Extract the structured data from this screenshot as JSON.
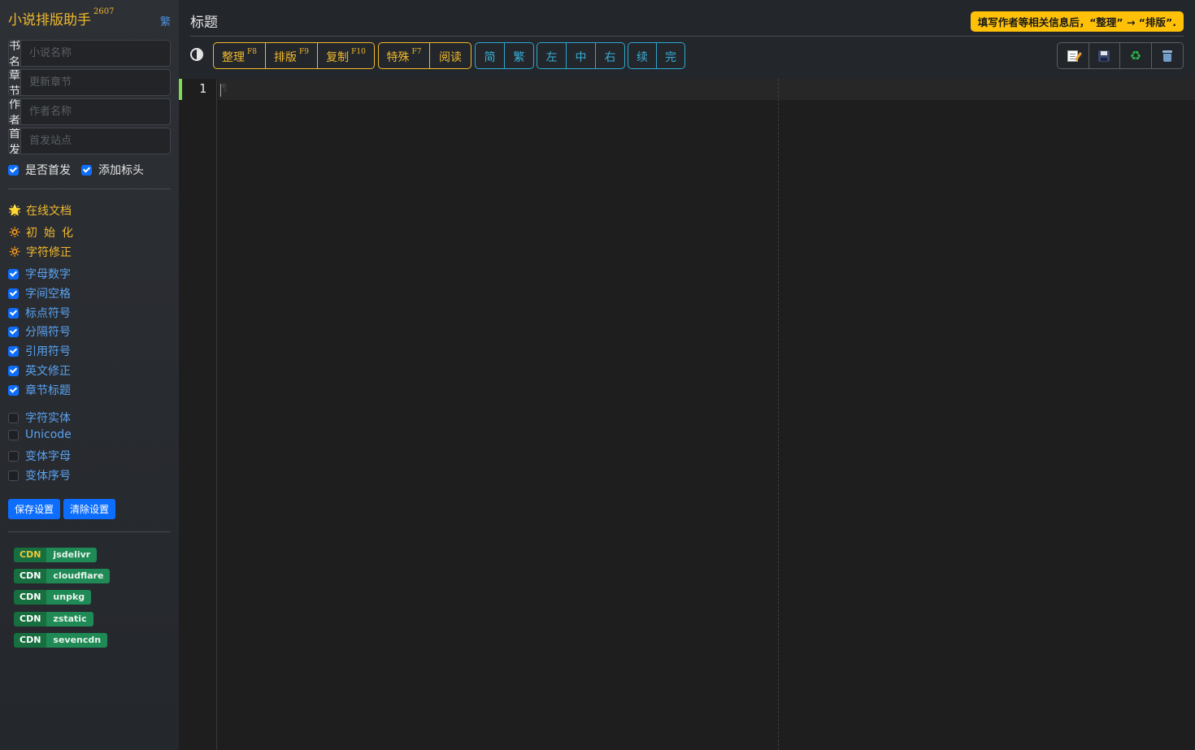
{
  "sidebar": {
    "app_name": "小说排版助手",
    "version": "2607",
    "trad_toggle": "繁",
    "fields": [
      {
        "label": "书名",
        "placeholder": "小说名称",
        "value": ""
      },
      {
        "label": "章节",
        "placeholder": "更新章节",
        "value": ""
      },
      {
        "label": "作者",
        "placeholder": "作者名称",
        "value": ""
      },
      {
        "label": "首发",
        "placeholder": "首发站点",
        "value": ""
      }
    ],
    "first_publish_label": "是否首发",
    "add_header_label": "添加标头",
    "actions": [
      {
        "icon": "star-icon",
        "label": "在线文档"
      },
      {
        "icon": "sun-icon",
        "label": "初始化"
      },
      {
        "icon": "sun-icon",
        "label": "字符修正"
      }
    ],
    "options_checked": [
      "字母数字",
      "字间空格",
      "标点符号",
      "分隔符号",
      "引用符号",
      "英文修正",
      "章节标题"
    ],
    "options_unchecked": [
      "字符实体",
      "Unicode",
      "变体字母",
      "变体序号"
    ],
    "save_label": "保存设置",
    "clear_label": "清除设置",
    "cdn_tag": "CDN",
    "cdns": [
      "jsdelivr",
      "cloudflare",
      "unpkg",
      "zstatic",
      "sevencdn"
    ]
  },
  "main": {
    "title": "标题",
    "hint": "填写作者等相关信息后，“整理” → “排版”.",
    "toolbar": {
      "group1": [
        {
          "label": "整理",
          "key": "F8"
        },
        {
          "label": "排版",
          "key": "F9"
        },
        {
          "label": "复制",
          "key": "F10"
        }
      ],
      "group2": [
        {
          "label": "特殊",
          "key": "F7"
        },
        {
          "label": "阅读",
          "key": ""
        }
      ],
      "group3": [
        "简",
        "繁"
      ],
      "group4": [
        "左",
        "中",
        "右"
      ],
      "group5": [
        "续",
        "完"
      ],
      "icons": [
        "memo-icon",
        "save-disk-icon",
        "recycle-icon",
        "trash-icon"
      ]
    },
    "editor": {
      "line_number": "1",
      "pilcrow": "¶"
    }
  },
  "colors": {
    "accent_yellow": "#f0b92c",
    "accent_cyan": "#2fa8d0",
    "primary_blue": "#0d6efd",
    "cdn_green": "#1f8a55",
    "active_line_marker": "#7ed957"
  }
}
